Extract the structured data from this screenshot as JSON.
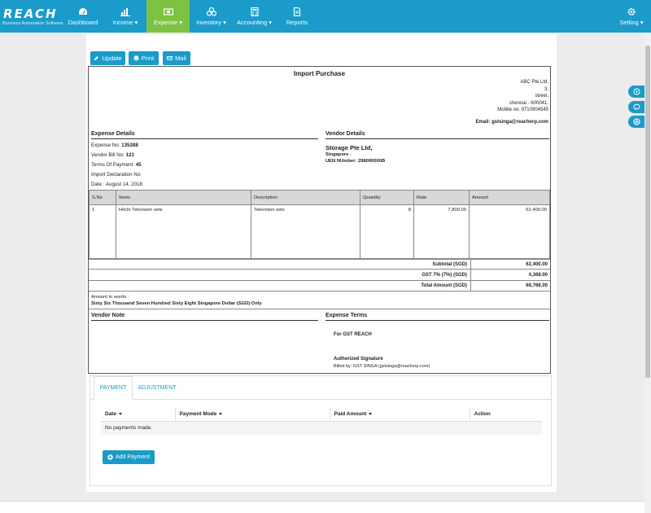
{
  "brand": {
    "logo": "REACH",
    "tagline": "Business Automation Software"
  },
  "nav": {
    "items": [
      {
        "label": "Dashboard",
        "icon": "dashboard-icon"
      },
      {
        "label": "Income",
        "icon": "bar-chart-icon",
        "dropdown": true
      },
      {
        "label": "Expense",
        "icon": "money-icon",
        "dropdown": true,
        "active": true
      },
      {
        "label": "Inventory",
        "icon": "cubes-icon",
        "dropdown": true
      },
      {
        "label": "Accounting",
        "icon": "calculator-icon",
        "dropdown": true
      },
      {
        "label": "Reports",
        "icon": "file-icon"
      }
    ],
    "setting_label": "Setting"
  },
  "toolbar": {
    "update_label": "Update",
    "print_label": "Print",
    "mail_label": "Mail"
  },
  "invoice": {
    "title": "Import Purchase",
    "company": {
      "name": "ABC Pte Ltd,",
      "line2": "3,",
      "line3": "street,",
      "line4": "chennai - 600041.",
      "mobile": "Mobile no: 9710904545",
      "email": "Email: gstsinga@reacherp.com"
    },
    "expense_details": {
      "heading": "Expense Details",
      "expense_no_label": "Expense No:",
      "expense_no": "135288",
      "vendor_bill_label": "Vendor Bill No:",
      "vendor_bill": "121",
      "terms_label": "Terms Of Payment:",
      "terms": "45",
      "import_decl": "Import Declaration No:",
      "date": "Date : August 14, 2018"
    },
    "vendor_details": {
      "heading": "Vendor Details",
      "name": "Storage Pte Ltd,",
      "country": "Singapore -",
      "uen": "UEN NUmber: 298000000B"
    },
    "table": {
      "headers": [
        "S.No",
        "Items",
        "Description",
        "Quantity",
        "Rate",
        "Amount"
      ],
      "rows": [
        {
          "sno": "1",
          "item": "Hitchi Television sets",
          "description": "Television sets",
          "quantity": "8",
          "rate": "7,800.00",
          "amount": "62,400.00"
        }
      ]
    },
    "totals": {
      "subtotal_label": "Subtotal (SGD)",
      "subtotal": "62,400.00",
      "gst_label": "GST 7% (7%) (SGD)",
      "gst": "4,368.00",
      "total_label": "Total Amount (SGD)",
      "total": "66,768.00"
    },
    "words_label": "Amount in words :",
    "words": "Sixty Six Thousand Seven Hundred Sixty Eight Singapore Dollar (SGD) Only",
    "vendor_note_heading": "Vendor Note",
    "expense_terms_heading": "Expense Terms",
    "for_company": "For GST REACH",
    "authorized": "Authorized Signature",
    "billed_by": "Billed by: GST SINGA (gstsinga@reacherp.com)"
  },
  "payment": {
    "tabs": [
      "PAYMENT",
      "ADJUSTMENT"
    ],
    "headers": [
      "Date",
      "Payment Mode",
      "Paid Amount",
      "Action"
    ],
    "empty_text": "No payments made.",
    "add_label": "Add Payment"
  },
  "colors": {
    "primary": "#1a9bc9",
    "active": "#7dc242"
  }
}
